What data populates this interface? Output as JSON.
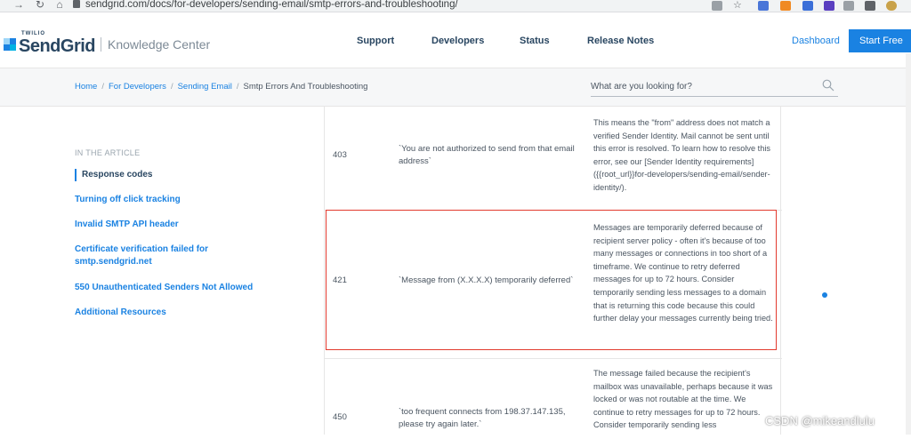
{
  "browser": {
    "url": "sendgrid.com/docs/for-developers/sending-email/smtp-errors-and-troubleshooting/"
  },
  "header": {
    "logo_top": "TWILIO",
    "logo_name": "SendGrid",
    "section_title": "Knowledge Center",
    "nav": [
      "Support",
      "Developers",
      "Status",
      "Release Notes"
    ],
    "dashboard_label": "Dashboard",
    "start_label": "Start Free",
    "accent": "#1a82e2",
    "brand_dark": "#294661"
  },
  "breadcrumb": {
    "items": [
      "Home",
      "For Developers",
      "Sending Email"
    ],
    "current": "Smtp Errors And Troubleshooting"
  },
  "search": {
    "placeholder": "What are you looking for?"
  },
  "toc": {
    "heading": "IN THE ARTICLE",
    "items": [
      "Response codes",
      "Turning off click tracking",
      "Invalid SMTP API header",
      "Certificate verification failed for smtp.sendgrid.net",
      "550 Unauthenticated Senders Not Allowed",
      "Additional Resources"
    ]
  },
  "table": {
    "rows": [
      {
        "code": "403",
        "message": "`You are not authorized to send from that email address`",
        "description": "This means the \"from\" address does not match a verified Sender Identity. Mail cannot be sent until this error is resolved. To learn how to resolve this error, see our [Sender Identity requirements]({{root_url}}for-developers/sending-email/sender-identity/)."
      },
      {
        "code": "421",
        "message": "`Message from (X.X.X.X) temporarily deferred`",
        "description": "Messages are temporarily deferred because of recipient server policy - often it's because of too many messages or connections in too short of a timeframe. We continue to retry deferred messages for up to 72 hours. Consider temporarily sending less messages to a domain that is returning this code because this could further delay your messages currently being tried."
      },
      {
        "code": "450",
        "message": "`too frequent connects from 198.37.147.135, please try again later.`",
        "description": "The message failed because the recipient's mailbox was unavailable, perhaps because it was locked or was not routable at the time. We continue to retry messages for up to 72 hours. Consider temporarily sending less"
      }
    ],
    "highlight_color": "#e23a2e"
  },
  "watermark": "CSDN @mikeandlulu"
}
